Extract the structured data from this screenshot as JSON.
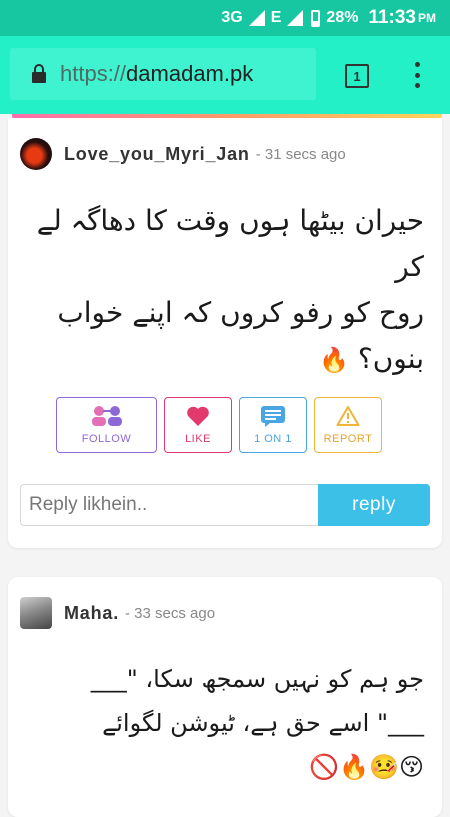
{
  "status_bar": {
    "network": "3G",
    "network2": "E",
    "battery": "28%",
    "time": "11:33",
    "ampm": "PM"
  },
  "browser": {
    "url_protocol": "https://",
    "url_host": "damadam.pk",
    "tab_count": "1"
  },
  "posts": [
    {
      "username": "Love_you_Myri_Jan",
      "time": "- 31 secs ago",
      "lines": [
        "حیران بیٹھا ہوں وقت کا دھاگہ لے کر",
        "روح کو رفو کروں کہ اپنے خواب بنوں؟"
      ],
      "emoji": "🔥"
    },
    {
      "username": "Maha.",
      "time": "- 33 secs ago",
      "lines": [
        "جو ہم کو نہیں سمجھ سکا، \"___",
        "___\" اسے حق ہے، ٹیوشن لگوائے"
      ],
      "emoji": "😚🤒🔥🚫"
    }
  ],
  "actions": {
    "follow": "FOLLOW",
    "like": "LIKE",
    "one_on_one": "1 ON 1",
    "report": "REPORT"
  },
  "reply": {
    "placeholder": "Reply likhein..",
    "button": "reply"
  },
  "colors": {
    "status_bar": "#16c7a2",
    "browser_bar": "#23f0c7",
    "reply_button": "#3cc0e8",
    "follow": "#8f68d8",
    "like": "#e23a6d",
    "one_on_one": "#4aa6e3",
    "report": "#f0b43a"
  }
}
